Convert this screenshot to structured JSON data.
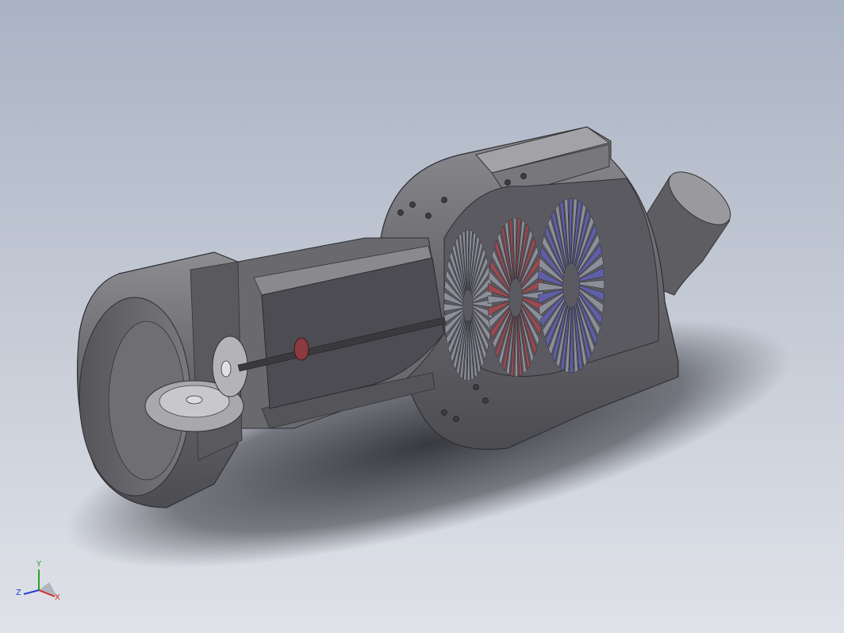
{
  "scene": {
    "description_colors": {
      "background_top": "#aab3c4",
      "background_bottom": "#dfe2e8",
      "casing": "#6d6d70",
      "casing_light": "#8a8a8e",
      "compressor_blade_red": "#9b4a4f",
      "compressor_blade_blue": "#5f5fa8",
      "blade_grey": "#8c8e99"
    }
  },
  "triad": {
    "x_label": "X",
    "y_label": "Y",
    "z_label": "Z",
    "x_color": "#d22b2b",
    "y_color": "#2ea02e",
    "z_color": "#2b3fd2"
  }
}
